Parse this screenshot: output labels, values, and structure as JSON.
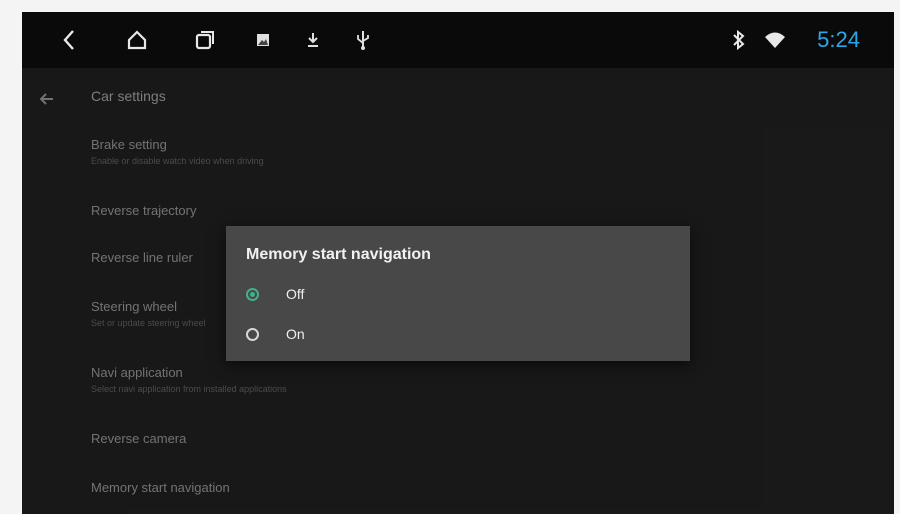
{
  "status_bar": {
    "icons": [
      "back-icon",
      "home-icon",
      "recent-apps-icon",
      "gallery-icon",
      "download-icon",
      "usb-icon",
      "bluetooth-icon",
      "wifi-icon"
    ],
    "time": "5:24",
    "time_color": "#2aa8e8"
  },
  "settings": {
    "title": "Car settings",
    "items": [
      {
        "title": "Brake setting",
        "subtitle": "Enable or disable watch video when driving"
      },
      {
        "title": "Reverse trajectory",
        "subtitle": ""
      },
      {
        "title": "Reverse line ruler",
        "subtitle": ""
      },
      {
        "title": "Steering wheel",
        "subtitle": "Set or update steering wheel"
      },
      {
        "title": "Navi application",
        "subtitle": "Select navi application from installed applications"
      },
      {
        "title": "Reverse camera",
        "subtitle": ""
      },
      {
        "title": "Memory start navigation",
        "subtitle": ""
      }
    ]
  },
  "dialog": {
    "title": "Memory start navigation",
    "options": [
      {
        "label": "Off",
        "selected": true
      },
      {
        "label": "On",
        "selected": false
      }
    ],
    "accent_color": "#3fb28a"
  }
}
